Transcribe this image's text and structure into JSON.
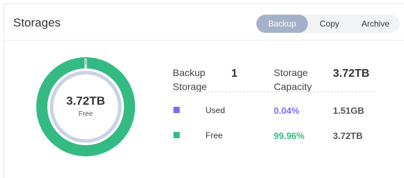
{
  "panel": {
    "title": "Storages"
  },
  "tabs": [
    {
      "label": "Backup",
      "active": true
    },
    {
      "label": "Copy",
      "active": false
    },
    {
      "label": "Archive",
      "active": false
    }
  ],
  "donut": {
    "center_value": "3.72TB",
    "center_label": "Free",
    "used_fraction": 0.0004,
    "free_fraction": 0.9996
  },
  "summary": {
    "backup_storage_label_line1": "Backup",
    "backup_storage_label_line2": "Storage",
    "backup_storage_count": "1",
    "storage_capacity_label_line1": "Storage",
    "storage_capacity_label_line2": "Capacity",
    "storage_capacity_value": "3.72TB"
  },
  "legend": [
    {
      "label": "Used",
      "percent": "0.04%",
      "amount": "1.51GB",
      "color": "#7b6ef0"
    },
    {
      "label": "Free",
      "percent": "99.96%",
      "amount": "3.72TB",
      "color": "#34bb84"
    }
  ],
  "colors": {
    "free": "#34bb84",
    "used": "#7b6ef0",
    "inner_ring": "#c8d3e6",
    "tab_active": "#a5b1c9"
  }
}
